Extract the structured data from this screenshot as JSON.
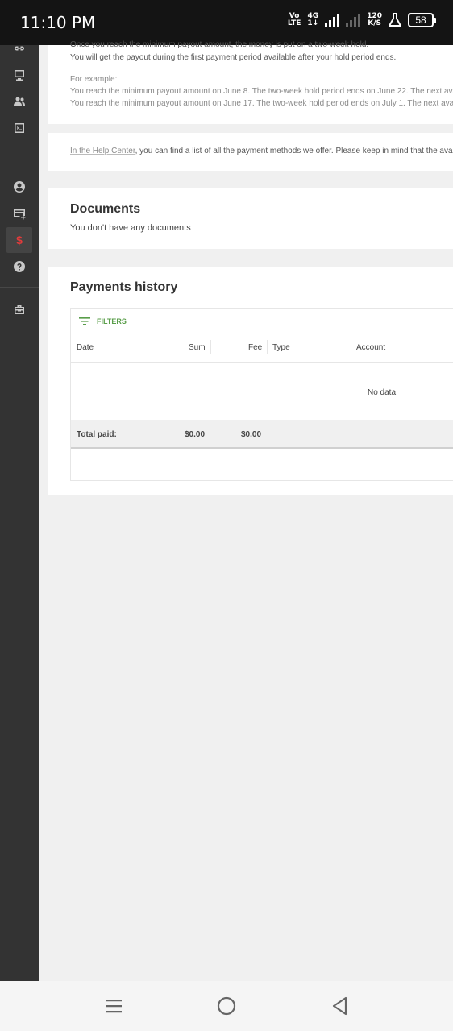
{
  "status_bar": {
    "time": "11:10 PM",
    "volte_top": "Vo",
    "volte_bottom": "LTE",
    "network_top": "4G",
    "network_bottom": "1↓",
    "speed_top": "120",
    "speed_bottom": "K/S",
    "battery": "58"
  },
  "sidebar": {
    "icons": [
      "link-icon",
      "monitor-icon",
      "users-icon",
      "terminal-icon",
      "account-icon",
      "payout-card-icon",
      "dollar-icon",
      "help-icon",
      "toolbox-icon"
    ],
    "dollar_glyph": "$",
    "accent": "#e23b3b"
  },
  "hold_info": {
    "line_cut": "Once you reach the minimum payout amount, the money is put on a two-week hold.",
    "line2": "You will get the payout during the first payment period available after your hold period ends.",
    "example_label": "For example:",
    "example1": "You reach the minimum payout amount on June 8. The two-week hold period ends on June 22. The next available",
    "example2": "You reach the minimum payout amount on June 17. The two-week hold period ends on July 1. The next available"
  },
  "help_center": {
    "link_text": "In the Help Center",
    "rest_text": ", you can find a list of all the payment methods we offer. Please keep in mind that the availability"
  },
  "documents": {
    "title": "Documents",
    "empty_text": "You don't have any documents"
  },
  "payments": {
    "title": "Payments history",
    "filters_label": "FILTERS",
    "filters_color": "#5a9e4a",
    "columns": {
      "date": "Date",
      "sum": "Sum",
      "fee": "Fee",
      "type": "Type",
      "account": "Account"
    },
    "no_data": "No data",
    "total_label": "Total paid:",
    "total_sum": "$0.00",
    "total_fee": "$0.00"
  },
  "navbar": {
    "icons": [
      "menu-icon",
      "home-icon",
      "back-icon"
    ]
  }
}
